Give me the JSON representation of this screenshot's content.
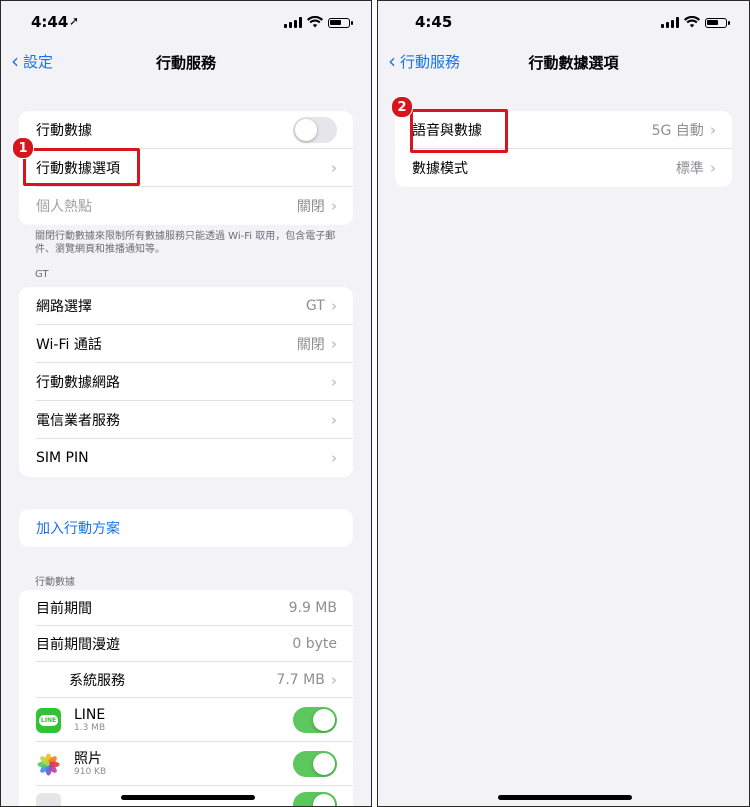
{
  "left": {
    "time": "4:44",
    "location_arrow": "➚",
    "back_label": "設定",
    "title": "行動服務",
    "group1": {
      "cellular_data": "行動數據",
      "cellular_data_options": "行動數據選項",
      "hotspot": "個人熱點",
      "hotspot_value": "關閉"
    },
    "footnote": "關閉行動數據來限制所有數據服務只能透過 Wi-Fi 取用，包含電子郵件、瀏覽網頁和推播通知等。",
    "carrier_header": "GT",
    "group2": [
      {
        "label": "網路選擇",
        "value": "GT"
      },
      {
        "label": "Wi-Fi 通話",
        "value": "關閉"
      },
      {
        "label": "行動數據網路",
        "value": ""
      },
      {
        "label": "電信業者服務",
        "value": ""
      },
      {
        "label": "SIM PIN",
        "value": ""
      }
    ],
    "add_plan": "加入行動方案",
    "data_header": "行動數據",
    "usage": {
      "current_period": "目前期間",
      "current_period_value": "9.9 MB",
      "roaming": "目前期間漫遊",
      "roaming_value": "0 byte",
      "system_services": "系統服務",
      "system_services_value": "7.7 MB"
    },
    "apps": [
      {
        "name": "LINE",
        "size": "1.3 MB",
        "icon": "line-app-icon",
        "icon_text": "LINE"
      },
      {
        "name": "照片",
        "size": "910 KB",
        "icon": "photos-app-icon"
      }
    ],
    "badge": "1"
  },
  "right": {
    "time": "4:45",
    "back_label": "行動服務",
    "title": "行動數據選項",
    "rows": [
      {
        "label": "語音與數據",
        "value": "5G 自動"
      },
      {
        "label": "數據模式",
        "value": "標準"
      }
    ],
    "badge": "2"
  },
  "colors": {
    "accent": "#1a73e8",
    "toggle_on": "#5bc75c",
    "highlight": "#d6151c",
    "background": "#f2f2f7"
  }
}
